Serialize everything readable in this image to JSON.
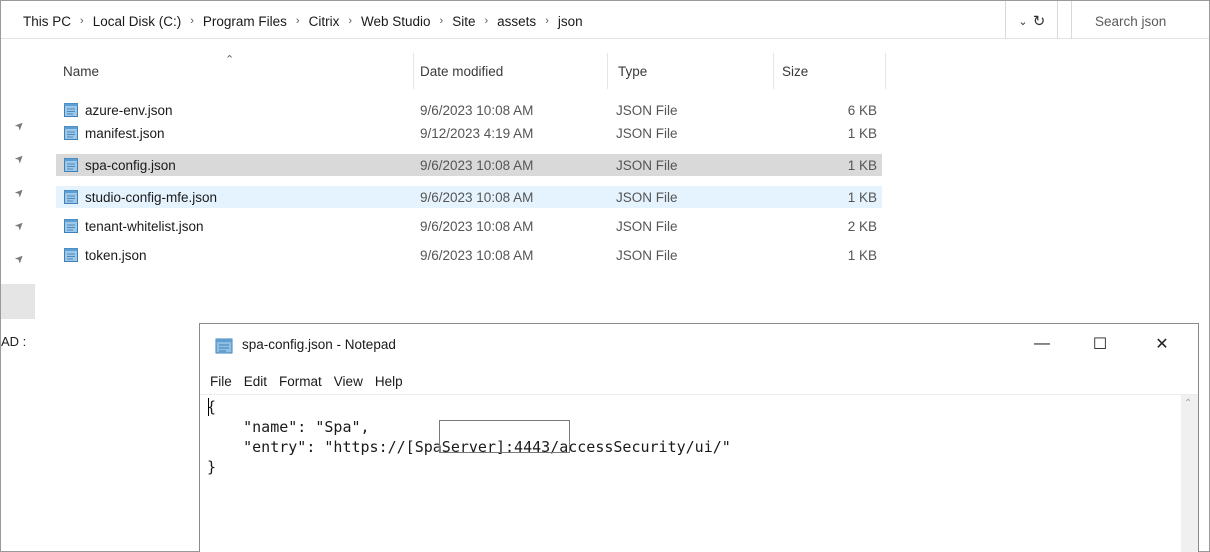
{
  "explorer": {
    "breadcrumbs": [
      "This PC",
      "Local Disk (C:)",
      "Program Files",
      "Citrix",
      "Web Studio",
      "Site",
      "assets",
      "json"
    ],
    "search_placeholder": "Search json",
    "nav_cut_text": "AD :",
    "columns": {
      "name": "Name",
      "date": "Date modified",
      "type": "Type",
      "size": "Size"
    },
    "files": [
      {
        "name": "azure-env.json",
        "date": "9/6/2023 10:08 AM",
        "type": "JSON File",
        "size": "6 KB",
        "state": "normal"
      },
      {
        "name": "manifest.json",
        "date": "9/12/2023 4:19 AM",
        "type": "JSON File",
        "size": "1 KB",
        "state": "normal"
      },
      {
        "name": "spa-config.json",
        "date": "9/6/2023 10:08 AM",
        "type": "JSON File",
        "size": "1 KB",
        "state": "selected"
      },
      {
        "name": "studio-config-mfe.json",
        "date": "9/6/2023 10:08 AM",
        "type": "JSON File",
        "size": "1 KB",
        "state": "hover"
      },
      {
        "name": "tenant-whitelist.json",
        "date": "9/6/2023 10:08 AM",
        "type": "JSON File",
        "size": "2 KB",
        "state": "normal"
      },
      {
        "name": "token.json",
        "date": "9/6/2023 10:08 AM",
        "type": "JSON File",
        "size": "1 KB",
        "state": "normal"
      }
    ]
  },
  "notepad": {
    "title": "spa-config.json - Notepad",
    "menu": [
      "File",
      "Edit",
      "Format",
      "View",
      "Help"
    ],
    "content_lines": [
      "{",
      "    \"name\": \"Spa\",",
      "    \"entry\": \"https://[SpaServer]:4443/accessSecurity/ui/\"",
      "}"
    ],
    "controls": {
      "minimize": "—",
      "maximize": "☐",
      "close": "✕"
    }
  },
  "colors": {
    "selected_row": "#d9d9d9",
    "hover_row": "#e5f3ff",
    "file_icon_blue": "#7fb2d8"
  }
}
